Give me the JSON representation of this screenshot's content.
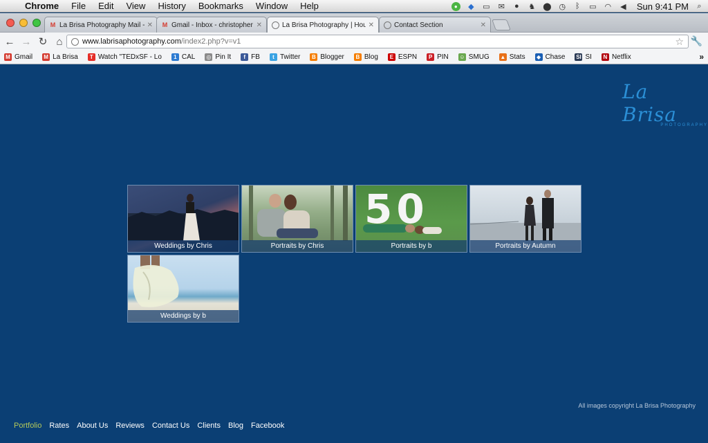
{
  "menubar": {
    "app": "Chrome",
    "items": [
      "File",
      "Edit",
      "View",
      "History",
      "Bookmarks",
      "Window",
      "Help"
    ],
    "clock": "Sun 9:41 PM"
  },
  "tabs": [
    {
      "title": "La Brisa Photography Mail - L",
      "icon": "gmail-icon"
    },
    {
      "title": "Gmail - Inbox - christopher",
      "icon": "gmail-icon"
    },
    {
      "title": "La Brisa Photography | Houst",
      "icon": "globe-icon",
      "active": true
    },
    {
      "title": "Contact Section",
      "icon": "globe-icon"
    }
  ],
  "address": {
    "host": "www.labrisaphotography.com",
    "path": "/index2.php?v=v1"
  },
  "bookmarks": [
    {
      "label": "Gmail",
      "color": "#d43a2f",
      "glyph": "M"
    },
    {
      "label": "La Brisa",
      "color": "#d43a2f",
      "glyph": "M"
    },
    {
      "label": "Watch \"TEDxSF - Lo",
      "color": "#e52d27",
      "glyph": "T"
    },
    {
      "label": "CAL",
      "color": "#2d7bd1",
      "glyph": "1"
    },
    {
      "label": "Pin It",
      "color": "#8a8a8a",
      "glyph": "◎"
    },
    {
      "label": "FB",
      "color": "#3b5998",
      "glyph": "f"
    },
    {
      "label": "Twitter",
      "color": "#3aa3e3",
      "glyph": "t"
    },
    {
      "label": "Blogger",
      "color": "#f57d00",
      "glyph": "B"
    },
    {
      "label": "Blog",
      "color": "#f57d00",
      "glyph": "B"
    },
    {
      "label": "ESPN",
      "color": "#cc0000",
      "glyph": "E"
    },
    {
      "label": "PIN",
      "color": "#cb2027",
      "glyph": "P"
    },
    {
      "label": "SMUG",
      "color": "#6aa84f",
      "glyph": "☺"
    },
    {
      "label": "Stats",
      "color": "#e8711a",
      "glyph": "▲"
    },
    {
      "label": "Chase",
      "color": "#1a5fb4",
      "glyph": "◆"
    },
    {
      "label": "SI",
      "color": "#2b3a55",
      "glyph": "SI"
    },
    {
      "label": "Netflix",
      "color": "#b20710",
      "glyph": "N"
    }
  ],
  "logo": {
    "script": "La Brisa",
    "sub": "PHOTOGRAPHY"
  },
  "gallery": [
    {
      "caption": "Weddings by Chris"
    },
    {
      "caption": "Portraits by Chris"
    },
    {
      "caption": "Portraits by b"
    },
    {
      "caption": "Portraits by Autumn"
    },
    {
      "caption": "Weddings by b"
    }
  ],
  "copyright": "All images copyright La Brisa Photography",
  "footer_nav": [
    {
      "label": "Portfolio",
      "active": true
    },
    {
      "label": "Rates"
    },
    {
      "label": "About Us"
    },
    {
      "label": "Reviews"
    },
    {
      "label": "Contact Us"
    },
    {
      "label": "Clients"
    },
    {
      "label": "Blog"
    },
    {
      "label": "Facebook"
    }
  ]
}
